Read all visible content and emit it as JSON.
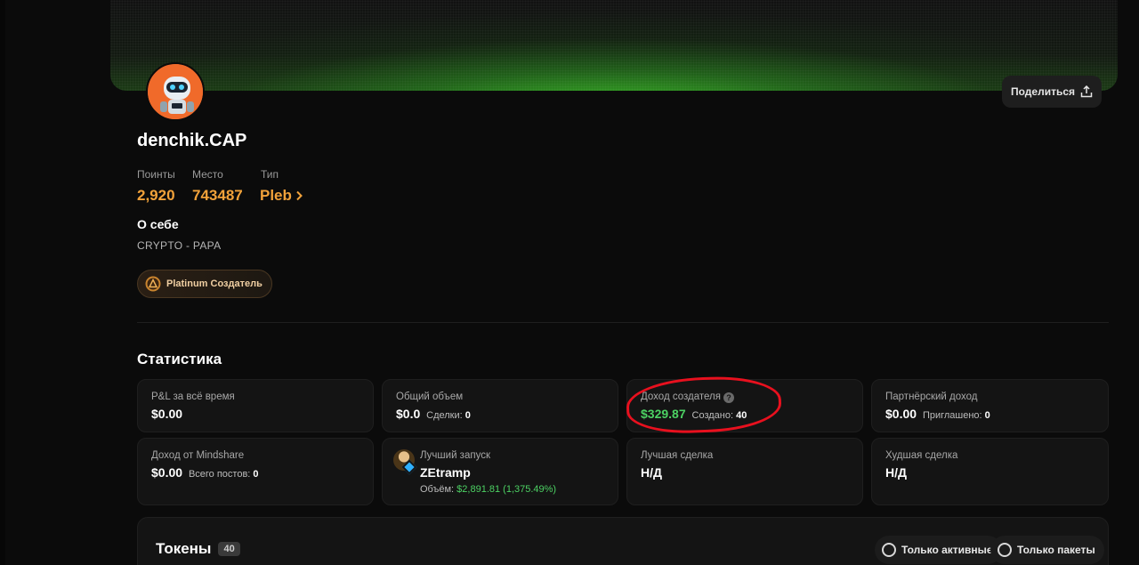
{
  "profile": {
    "username": "denchik.CAP",
    "share_label": "Поделиться",
    "stats_meta": {
      "points_label": "Поинты",
      "points_value": "2,920",
      "rank_label": "Место",
      "rank_value": "743487",
      "type_label": "Тип",
      "type_value": "Pleb"
    },
    "about_title": "О себе",
    "about_text": "CRYPTO - PAPA",
    "badge_label": "Platinum Создатель"
  },
  "statistics": {
    "title": "Статистика",
    "pnl": {
      "label": "P&L за всё время",
      "value": "$0.00"
    },
    "volume": {
      "label": "Общий объем",
      "value": "$0.0",
      "sub_label": "Сделки:",
      "sub_value": "0"
    },
    "creator_income": {
      "label": "Доход создателя",
      "value": "$329.87",
      "sub_label": "Создано:",
      "sub_value": "40"
    },
    "partner_income": {
      "label": "Партнёрский доход",
      "value": "$0.00",
      "sub_label": "Приглашено:",
      "sub_value": "0"
    },
    "mindshare": {
      "label": "Доход от Mindshare",
      "value": "$0.00",
      "sub_label": "Всего постов:",
      "sub_value": "0"
    },
    "best_launch": {
      "label": "Лучший запуск",
      "token": "ZEtramp",
      "volume_label": "Объём:",
      "volume_value": "$2,891.81 (1,375.49%)"
    },
    "best_trade": {
      "label": "Лучшая сделка",
      "value": "Н/Д"
    },
    "worst_trade": {
      "label": "Худшая сделка",
      "value": "Н/Д"
    }
  },
  "tokens": {
    "title": "Токены",
    "count": "40",
    "filter_active": "Только активные",
    "filter_bundles": "Только пакеты"
  },
  "colors": {
    "accent_orange": "#f2a23a",
    "positive_green": "#4cd163",
    "annotation_red": "#e8101e"
  }
}
